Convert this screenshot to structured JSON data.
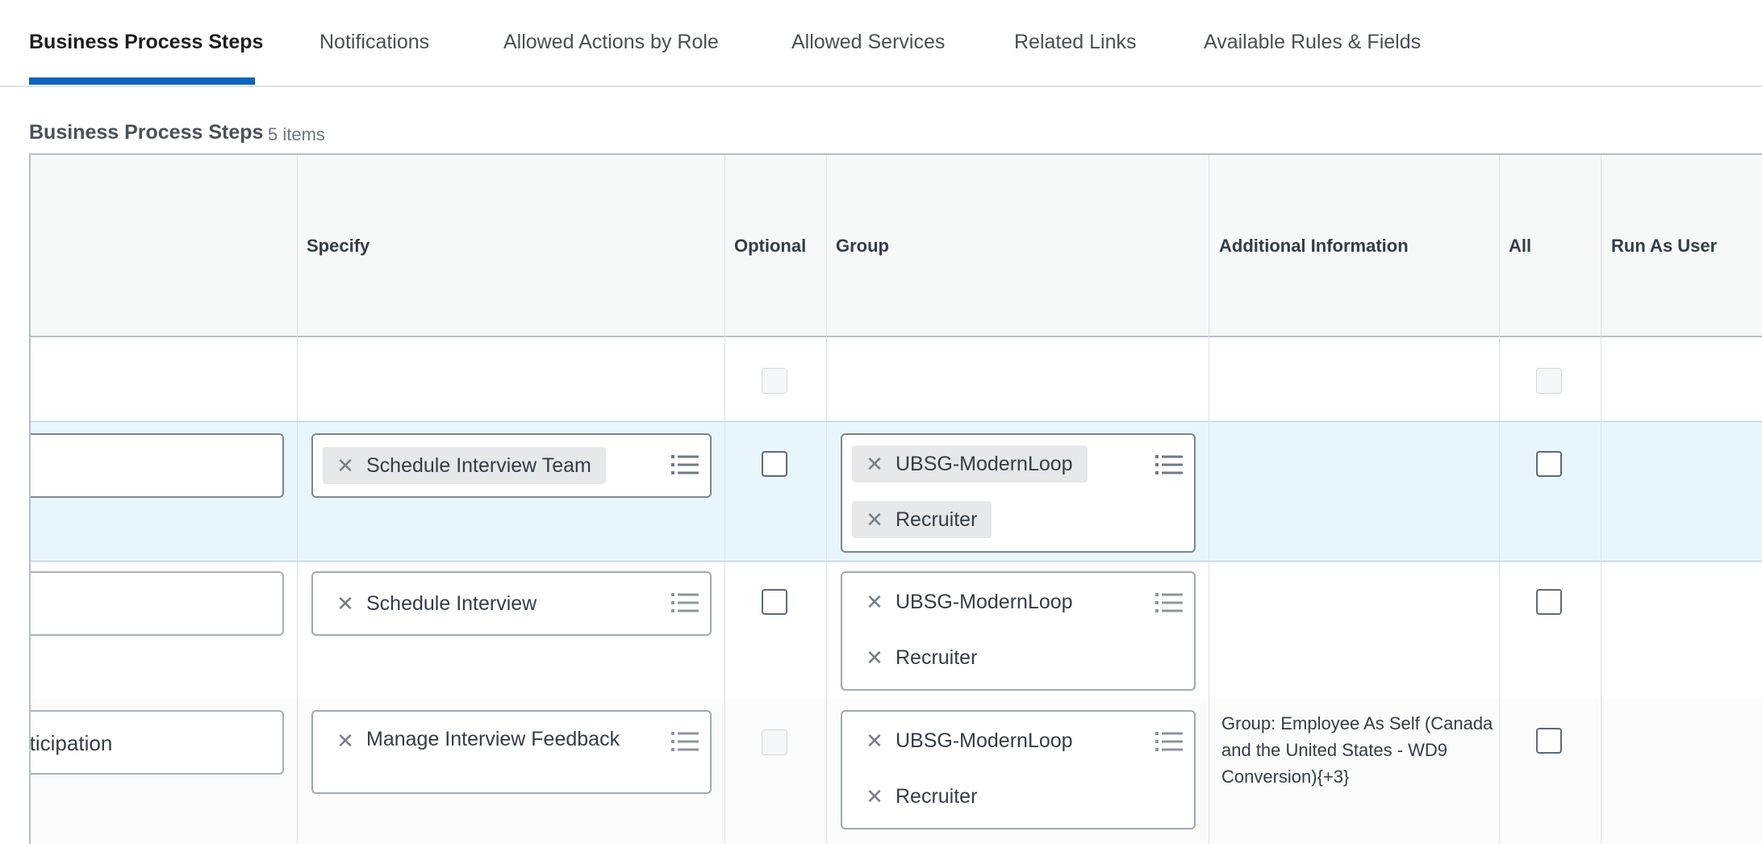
{
  "tabs": [
    {
      "label": "Business Process Steps",
      "active": true
    },
    {
      "label": "Notifications",
      "active": false
    },
    {
      "label": "Allowed Actions by Role",
      "active": false
    },
    {
      "label": "Allowed Services",
      "active": false
    },
    {
      "label": "Related Links",
      "active": false
    },
    {
      "label": "Available Rules & Fields",
      "active": false
    }
  ],
  "section": {
    "title": "Business Process Steps",
    "count": "5 items"
  },
  "columns": {
    "specify": "Specify",
    "optional": "Optional",
    "group": "Group",
    "additional_information": "Additional Information",
    "all": "All",
    "run_as_user": "Run As User"
  },
  "rows": [
    {
      "name": "",
      "specify": "",
      "optional_checked": false,
      "all_checked": false,
      "groups": [],
      "additional_information": ""
    },
    {
      "name": "",
      "specify": "Schedule Interview Team",
      "optional_checked": false,
      "all_checked": false,
      "groups": [
        "UBSG-ModernLoop",
        "Recruiter"
      ],
      "additional_information": ""
    },
    {
      "name": "",
      "specify": "Schedule Interview",
      "optional_checked": false,
      "all_checked": false,
      "groups": [
        "UBSG-ModernLoop",
        "Recruiter"
      ],
      "additional_information": ""
    },
    {
      "name": "rticipation",
      "specify": "Manage Interview Feedback",
      "optional_checked": false,
      "all_checked": false,
      "groups": [
        "UBSG-ModernLoop",
        "Recruiter"
      ],
      "additional_information": "Group: Employee As Self (Canada and the United States - WD9 Conversion){+3}"
    }
  ],
  "icons": {
    "remove": "close-icon",
    "prompt": "list-icon"
  },
  "colors": {
    "accent": "#0b64c0",
    "selected_row": "#e8f6fb"
  }
}
